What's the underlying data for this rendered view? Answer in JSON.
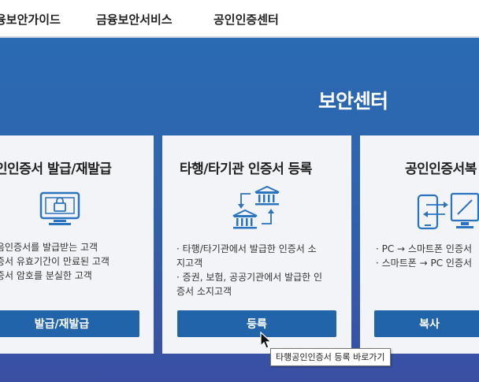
{
  "nav": {
    "items": [
      "융보안가이드",
      "금융보안서비스",
      "공인인증센터"
    ]
  },
  "hero": {
    "title": "보안센터"
  },
  "cards": [
    {
      "title": "인인증서 발급/재발급",
      "desc": [
        "음인증서를 발급받는 고객",
        "증서 유효기간이 만료된 고객",
        "증서 암호를 분실한 고객"
      ],
      "button": "발급/재발급"
    },
    {
      "title": "타행/타기관 인증서 등록",
      "desc": [
        "· 타행/타기관에서 발급한 인증서 소",
        "  지고객",
        "· 증권, 보험, 공공기관에서 발급한 인",
        "  증서 소지고객"
      ],
      "button": "등록"
    },
    {
      "title": "공인인증서복",
      "desc": [
        "· PC → 스마트폰 인증서",
        "· 스마트폰 → PC 인증서"
      ],
      "button": "복사"
    }
  ],
  "tooltip": "타행공인인증서 등록 바로가기",
  "colors": {
    "accent": "#2264aa",
    "hero": "#2f68b0",
    "icon": "#2a73c0"
  }
}
